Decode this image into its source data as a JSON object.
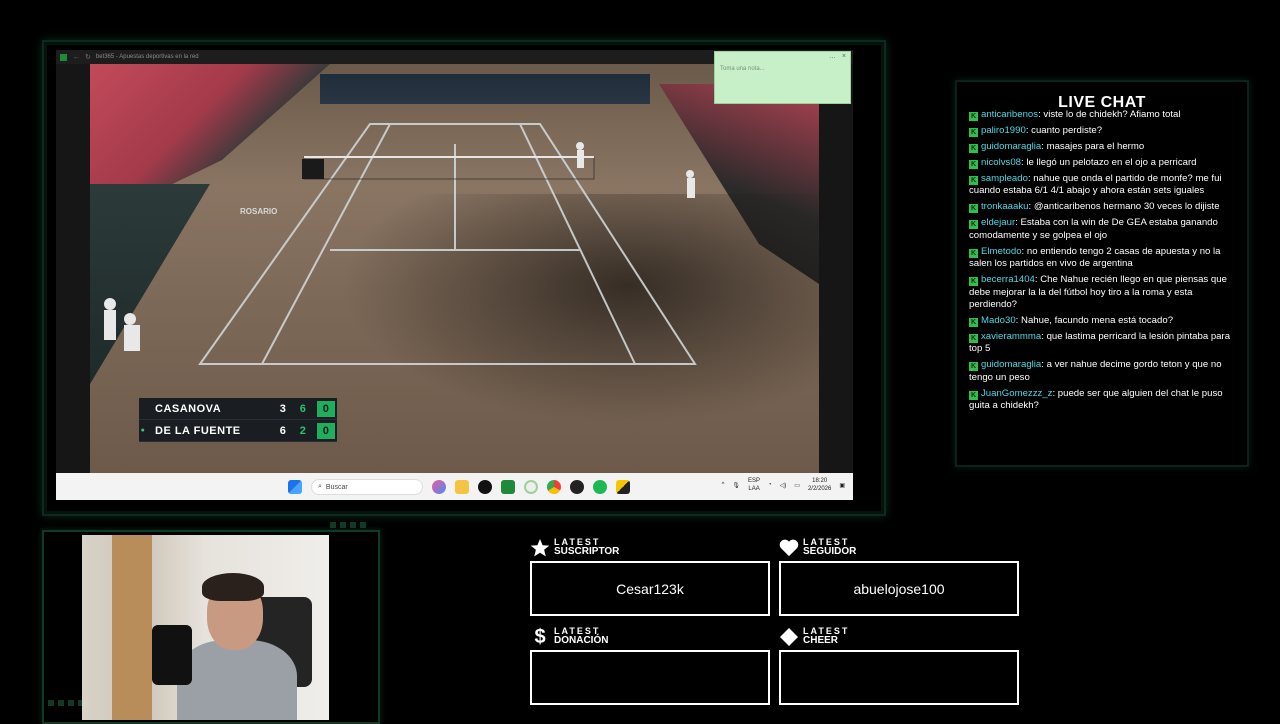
{
  "browser": {
    "tab_title": "bet365 - Apuestas deportivas en la red",
    "note_placeholder": "Toma una nota...",
    "note_controls": [
      "…",
      "×"
    ]
  },
  "scoreboard": {
    "players": [
      {
        "name": "CASANOVA",
        "set1": "3",
        "set2": "6",
        "points": "0",
        "serving": false
      },
      {
        "name": "DE LA FUENTE",
        "set1": "6",
        "set2": "2",
        "points": "0",
        "serving": true
      }
    ],
    "serve_marker": "●"
  },
  "court_ads": {
    "banner": "ROSARIO"
  },
  "taskbar": {
    "search_placeholder": "Buscar",
    "lang_line1": "ESP",
    "lang_line2": "LAA",
    "time": "18:20",
    "date": "2/2/2026"
  },
  "chat": {
    "title": "LIVE CHAT",
    "badge": "K",
    "messages": [
      {
        "user": "anticaribenos",
        "text": "viste lo de chidekh? Afiamo total"
      },
      {
        "user": "paliro1990",
        "text": "cuanto perdiste?"
      },
      {
        "user": "guidomaraglia",
        "text": "masajes para el hermo"
      },
      {
        "user": "nicolvs08",
        "text": "le llegó un pelotazo en el ojo a perricard"
      },
      {
        "user": "sampleado",
        "text": "nahue que onda el partido de monfe? me fui cuando estaba 6/1 4/1 abajo y ahora están sets iguales"
      },
      {
        "user": "tronkaaaku",
        "text": "@anticaribenos hermano 30 veces lo dijiste"
      },
      {
        "user": "eldejaur",
        "text": "Estaba con la win de De GEA estaba ganando comodamente y se golpea el ojo"
      },
      {
        "user": "Elmetodo",
        "text": "no entiendo tengo 2 casas de apuesta y no la salen los partidos en vivo de argentina"
      },
      {
        "user": "becerra1404",
        "text": "Che Nahue recién llego en que piensas que debe mejorar la la del fútbol hoy tiro a la roma y esta perdiendo?"
      },
      {
        "user": "Mado30",
        "text": "Nahue, facundo mena está tocado?"
      },
      {
        "user": "xavierammma",
        "text": "que lastima perricard la lesión pintaba para top 5"
      },
      {
        "user": "guidomaraglia",
        "text": "a ver nahue decime gordo teton y que no tengo un peso"
      },
      {
        "user": "JuanGomezzz_z",
        "text": "puede ser que alguien del chat le puso guita a chidekh?"
      }
    ]
  },
  "widgets": {
    "suscriptor": {
      "small": "LATEST",
      "big": "SUSCRIPTOR",
      "value": "Cesar123k"
    },
    "seguidor": {
      "small": "LATEST",
      "big": "SEGUIDOR",
      "value": "abuelojose100"
    },
    "donacion": {
      "small": "LATEST",
      "big": "DONACIÓN",
      "value": ""
    },
    "cheer": {
      "small": "LATEST",
      "big": "CHEER",
      "value": ""
    }
  },
  "icons": {
    "star": "star-icon",
    "heart": "heart-icon",
    "dollar": "dollar-icon",
    "diamond": "diamond-icon"
  },
  "colors": {
    "accent_green": "#1fae5e",
    "chat_username": "#4fd8e8",
    "frame_green": "#0f3a26",
    "note_bg": "#c8f0c8"
  }
}
